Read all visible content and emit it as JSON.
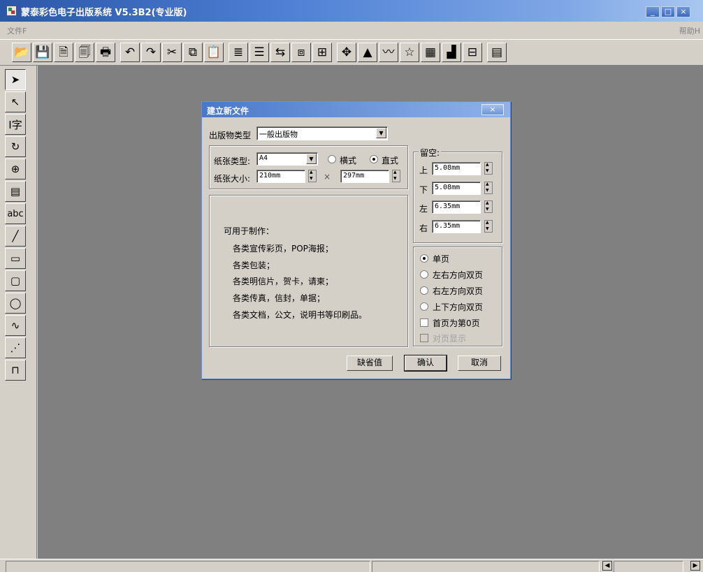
{
  "window": {
    "title": "蒙泰彩色电子出版系统 V5.3B2(专业版)",
    "min": "_",
    "max": "□",
    "close": "×"
  },
  "menu": {
    "file": "文件F",
    "help": "帮助H"
  },
  "toolbar": {
    "buttons": [
      {
        "name": "open-icon",
        "glyph": "📂"
      },
      {
        "name": "save-icon",
        "glyph": "💾"
      },
      {
        "name": "page-setup-icon",
        "glyph": "🗎"
      },
      {
        "name": "page-prop-icon",
        "glyph": "🗐"
      },
      {
        "name": "print-icon",
        "glyph": "🖶"
      },
      {
        "name": "undo-icon",
        "glyph": "↶"
      },
      {
        "name": "redo-icon",
        "glyph": "↷"
      },
      {
        "name": "cut-icon",
        "glyph": "✂"
      },
      {
        "name": "copy-icon",
        "glyph": "⧉"
      },
      {
        "name": "paste-icon",
        "glyph": "📋"
      },
      {
        "name": "text-flow-icon",
        "glyph": "≣"
      },
      {
        "name": "text-block-icon",
        "glyph": "☰"
      },
      {
        "name": "align-icon",
        "glyph": "⇆"
      },
      {
        "name": "stack-icon",
        "glyph": "⧈"
      },
      {
        "name": "group-icon",
        "glyph": "⊞"
      },
      {
        "name": "move-icon",
        "glyph": "✥"
      },
      {
        "name": "shapes-color-icon",
        "glyph": "▲"
      },
      {
        "name": "rainbow-icon",
        "glyph": "〰"
      },
      {
        "name": "star-icon",
        "glyph": "☆"
      },
      {
        "name": "map-icon",
        "glyph": "▦"
      },
      {
        "name": "image-icon",
        "glyph": "▟"
      },
      {
        "name": "table-text-icon",
        "glyph": "⊟"
      },
      {
        "name": "preview-icon",
        "glyph": "▤"
      }
    ]
  },
  "palette": {
    "tools": [
      {
        "name": "select-arrow-icon",
        "glyph": "➤",
        "active": true
      },
      {
        "name": "node-select-icon",
        "glyph": "↖"
      },
      {
        "name": "text-tool-icon",
        "glyph": "I字"
      },
      {
        "name": "rotate-icon",
        "glyph": "↻"
      },
      {
        "name": "zoom-icon",
        "glyph": "⊕"
      },
      {
        "name": "page-icon",
        "glyph": "▤"
      },
      {
        "name": "text-frame-icon",
        "glyph": "abc"
      },
      {
        "name": "line-icon",
        "glyph": "╱"
      },
      {
        "name": "rectangle-icon",
        "glyph": "▭"
      },
      {
        "name": "rounded-rect-icon",
        "glyph": "▢"
      },
      {
        "name": "ellipse-icon",
        "glyph": "◯"
      },
      {
        "name": "curve-icon",
        "glyph": "∿"
      },
      {
        "name": "dotted-line-icon",
        "glyph": "⋰"
      },
      {
        "name": "table-icon",
        "glyph": "⊓"
      }
    ]
  },
  "dialog": {
    "title": "建立新文件",
    "close": "×",
    "pub_type_label": "出版物类型",
    "pub_type_value": "一般出版物",
    "paper_type_label": "纸张类型:",
    "paper_type_value": "A4",
    "landscape_label": "横式",
    "portrait_label": "直式",
    "paper_size_label": "纸张大小:",
    "width": "210mm",
    "times": "×",
    "height": "297mm",
    "margins_title": "留空:",
    "margin_top_label": "上",
    "margin_top": "5.08mm",
    "margin_bottom_label": "下",
    "margin_bottom": "5.08mm",
    "margin_left_label": "左",
    "margin_left": "6.35mm",
    "margin_right_label": "右",
    "margin_right": "6.35mm",
    "desc_heading": "可用于制作：",
    "desc_lines": [
      "各类宣传彩页，POP海报；",
      "各类包装；",
      "各类明信片，贺卡，请柬；",
      "各类传真，信封，单据；",
      "各类文档，公文，说明书等印刷品。"
    ],
    "page_options": [
      "单页",
      "左右方向双页",
      "右左方向双页",
      "上下方向双页"
    ],
    "first_page_zero": "首页为第0页",
    "facing_pages": "对页显示",
    "btn_default": "缺省值",
    "btn_ok": "确认",
    "btn_cancel": "取消"
  }
}
